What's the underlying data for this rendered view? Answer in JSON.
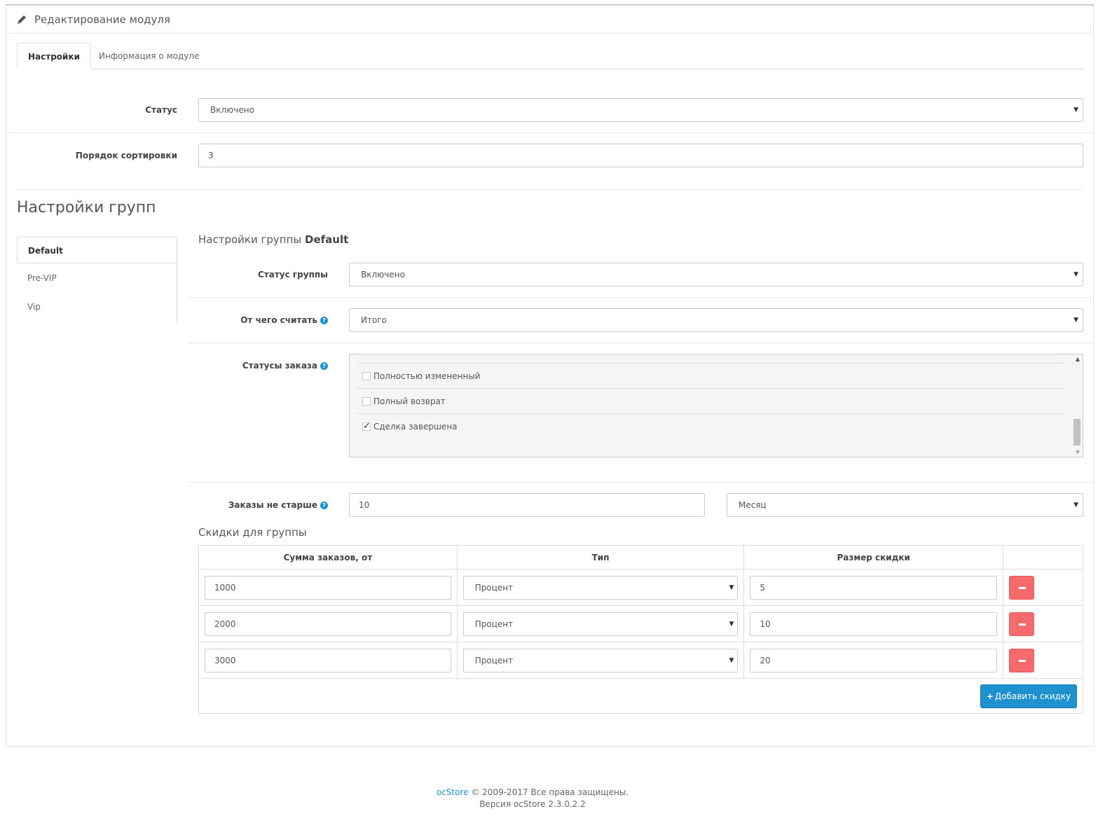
{
  "header": {
    "title": "Редактирование модуля",
    "icon": "pencil-icon"
  },
  "tabs": [
    {
      "label": "Настройки",
      "active": true
    },
    {
      "label": "Информация о модуле",
      "active": false
    }
  ],
  "form": {
    "status_label": "Статус",
    "status_value": "Включено",
    "sort_label": "Порядок сортировки",
    "sort_value": "3"
  },
  "groups": {
    "heading": "Настройки групп",
    "nav": [
      "Default",
      "Pre-VIP",
      "Vip"
    ],
    "active": "Default"
  },
  "group_settings": {
    "heading_prefix": "Настройки группы",
    "heading_name": "Default",
    "group_status_label": "Статус группы",
    "group_status_value": "Включено",
    "calc_from_label": "От чего считать",
    "calc_from_value": "Итого",
    "order_statuses_label": "Статусы заказа",
    "order_statuses": [
      {
        "label": "Полностью измененный",
        "checked": false
      },
      {
        "label": "Полный возврат",
        "checked": false
      },
      {
        "label": "Сделка завершена",
        "checked": true
      }
    ],
    "orders_age_label": "Заказы не старше",
    "orders_age_value": "10",
    "orders_age_unit": "Месяц"
  },
  "discounts": {
    "title": "Скидки для группы",
    "columns": [
      "Сумма заказов, от",
      "Тип",
      "Размер скидки"
    ],
    "rows": [
      {
        "amount": "1000",
        "type": "Процент",
        "size": "5"
      },
      {
        "amount": "2000",
        "type": "Процент",
        "size": "10"
      },
      {
        "amount": "3000",
        "type": "Процент",
        "size": "20"
      }
    ],
    "add_button": "Добавить скидку"
  },
  "footer": {
    "brand": "ocStore",
    "copyright": "© 2009-2017 Все права защищены.",
    "version": "Версия ocStore 2.3.0.2.2"
  },
  "colors": {
    "primary": "#1e91cf",
    "danger": "#f56b6b"
  }
}
